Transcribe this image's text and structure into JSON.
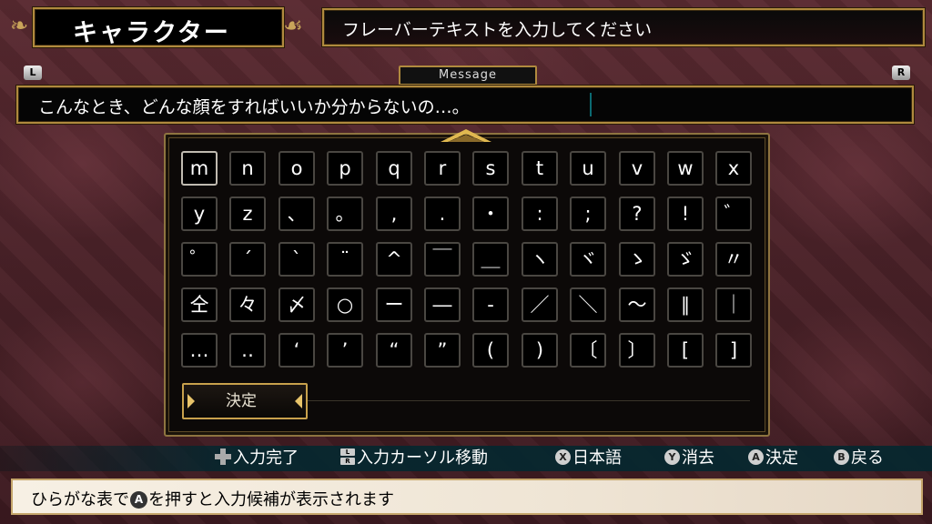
{
  "header": {
    "title": "キャラクター",
    "prompt": "フレーバーテキストを入力してください"
  },
  "shoulder": {
    "left": "L",
    "right": "R"
  },
  "message": {
    "label": "Message",
    "value": "こんなとき、どんな顔をすればいいか分からないの…。"
  },
  "keyboard": {
    "rows": [
      [
        "m",
        "n",
        "o",
        "p",
        "q",
        "r",
        "s",
        "t",
        "u",
        "v",
        "w",
        "x"
      ],
      [
        "y",
        "z",
        "、",
        "。",
        ",",
        ".",
        "・",
        ":",
        ";",
        "?",
        "!",
        "゛"
      ],
      [
        "゜",
        "´",
        "`",
        "¨",
        "^",
        "￣",
        "＿",
        "ヽ",
        "ヾ",
        "ゝ",
        "ゞ",
        "〃"
      ],
      [
        "仝",
        "々",
        "〆",
        "○",
        "ー",
        "―",
        "‐",
        "／",
        "＼",
        "～",
        "∥",
        "｜"
      ],
      [
        "…",
        "‥",
        "‘",
        "’",
        "“",
        "”",
        "(",
        ")",
        "〔",
        "〕",
        "[",
        "]"
      ]
    ],
    "selected_key": "m",
    "ok_label": "決定"
  },
  "help": {
    "finish": "入力完了",
    "cursor": "入力カーソル移動",
    "japanese": "日本語",
    "delete": "消去",
    "confirm": "決定",
    "back": "戻る",
    "icons": {
      "x": "X",
      "y": "Y",
      "a": "A",
      "b": "B",
      "l": "L",
      "r": "R"
    }
  },
  "hint": {
    "before": "ひらがな表で",
    "button": "A",
    "after": "を押すと入力候補が表示されます"
  },
  "colors": {
    "gold": "#b08a3e",
    "help_bg": "#00282f",
    "hint_bg": "#f7f0e4"
  }
}
